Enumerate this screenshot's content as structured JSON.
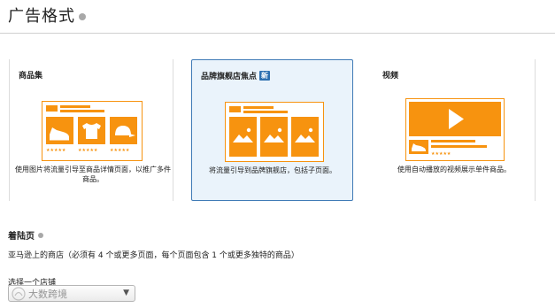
{
  "header": {
    "title": "广告格式"
  },
  "cards": [
    {
      "title": "商品集",
      "desc": "使用图片将流量引导至商品详情页面，以推广多件商品。",
      "stars": "★★★★★"
    },
    {
      "title": "品牌旗舰店焦点",
      "badge": "新",
      "desc": "将流量引导到品牌旗舰店，包括子页面。"
    },
    {
      "title": "视频",
      "desc": "使用自动播放的视频展示单件商品。",
      "stars": "★★★★★"
    }
  ],
  "landing": {
    "label": "着陆页",
    "desc": "亚马逊上的商店（必须有 4 个或更多页面，每个页面包含 1 个或更多独特的商品）",
    "select_label": "选择一个店铺",
    "select_value": "大数跨境"
  },
  "colors": {
    "accent_orange": "#f7930f",
    "selected_border": "#3f7ab6",
    "selected_bg": "#eaf3fb",
    "badge_blue": "#2d6fb0"
  },
  "icons": {
    "info": "info-icon",
    "shoe": "shoe-icon",
    "shirt": "tshirt-icon",
    "cap": "cap-icon",
    "landscape": "image-icon",
    "play": "play-icon",
    "chevron": "chevron-down-icon"
  }
}
